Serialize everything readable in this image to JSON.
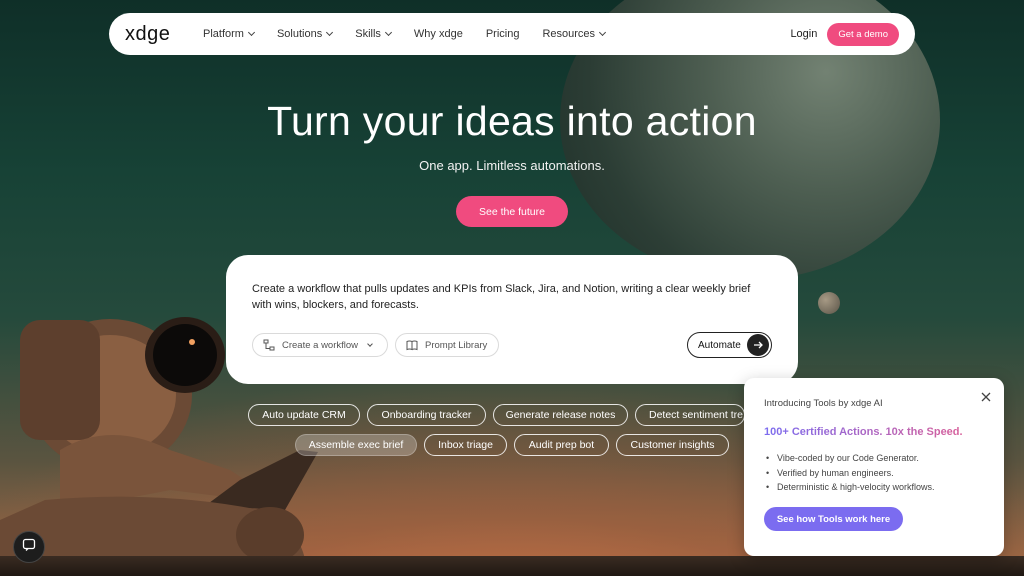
{
  "nav": {
    "logo": "xdge",
    "links": [
      {
        "label": "Platform",
        "dropdown": true
      },
      {
        "label": "Solutions",
        "dropdown": true
      },
      {
        "label": "Skills",
        "dropdown": true
      },
      {
        "label": "Why xdge",
        "dropdown": false
      },
      {
        "label": "Pricing",
        "dropdown": false
      },
      {
        "label": "Resources",
        "dropdown": true
      }
    ],
    "login": "Login",
    "demo": "Get a demo"
  },
  "hero": {
    "title": "Turn your ideas into action",
    "subtitle": "One app. Limitless automations.",
    "cta": "See the future"
  },
  "prompt": {
    "text": "Create a workflow that pulls updates and KPIs from Slack, Jira, and Notion, writing a clear weekly brief with wins, blockers, and forecasts.",
    "mode_select": "Create a workflow",
    "library": "Prompt Library",
    "submit": "Automate"
  },
  "suggestions": [
    "Auto update CRM",
    "Onboarding tracker",
    "Generate release notes",
    "Detect sentiment tre",
    "Assemble exec brief",
    "Inbox triage",
    "Audit prep bot",
    "Customer insights"
  ],
  "active_suggestion": "Assemble exec brief",
  "popup": {
    "intro": "Introducing Tools by xdge AI",
    "headline": "100+ Certified Actions. 10x the Speed.",
    "bullets": [
      "Vibe-coded by our Code Generator.",
      "Verified by human engineers.",
      "Deterministic & high-velocity workflows."
    ],
    "cta": "See how Tools work here"
  },
  "colors": {
    "accent": "#f04b7f",
    "popup_accent": "#7b6cf0"
  }
}
